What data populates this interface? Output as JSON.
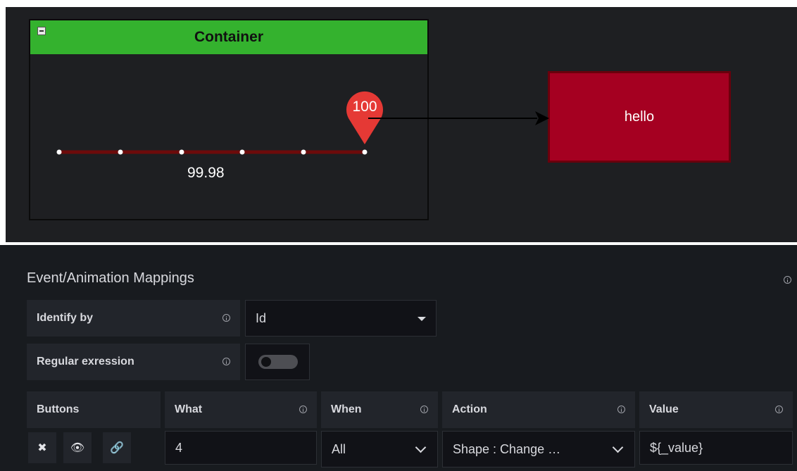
{
  "diagram": {
    "container_title": "Container",
    "collapse_icon": "minus-square-icon",
    "marker_value": "100",
    "gauge_value": "99.98",
    "target_label": "hello",
    "colors": {
      "background": "#1e1f22",
      "container_header": "#34b22e",
      "target_fill": "#a50021",
      "target_border": "#6a000c",
      "marker": "#e53935",
      "line": "#6d0b0b"
    }
  },
  "panel": {
    "title": "Event/Animation Mappings",
    "identify_by": {
      "label": "Identify by",
      "value": "Id"
    },
    "regular_expression": {
      "label": "Regular exression",
      "enabled": false
    },
    "table": {
      "headers": [
        "Buttons",
        "What",
        "When",
        "Action",
        "Value"
      ],
      "row": {
        "buttons": [
          "close-icon",
          "eye-icon",
          "link-icon"
        ],
        "what": "4",
        "when": "All",
        "action": "Shape : Change …",
        "value": "${_value}"
      }
    }
  }
}
